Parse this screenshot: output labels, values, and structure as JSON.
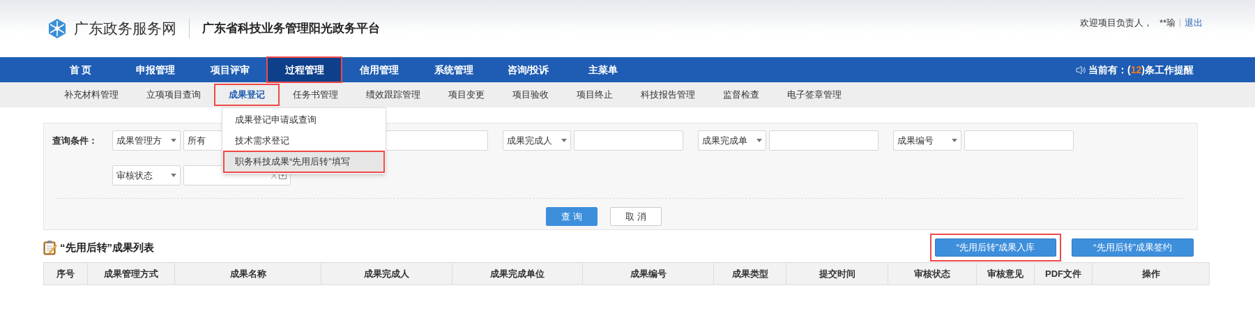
{
  "header": {
    "portal_name": "广东政务服务网",
    "platform_title": "广东省科技业务管理阳光政务平台",
    "welcome": "欢迎项目负责人，",
    "user": "**瑜",
    "logout": "退出"
  },
  "main_nav": {
    "items": [
      {
        "label": "首 页",
        "selected": false,
        "highlighted": false
      },
      {
        "label": "申报管理",
        "selected": false,
        "highlighted": false
      },
      {
        "label": "项目评审",
        "selected": false,
        "highlighted": false
      },
      {
        "label": "过程管理",
        "selected": true,
        "highlighted": true
      },
      {
        "label": "信用管理",
        "selected": false,
        "highlighted": false
      },
      {
        "label": "系统管理",
        "selected": false,
        "highlighted": false
      },
      {
        "label": "咨询/投诉",
        "selected": false,
        "highlighted": false
      },
      {
        "label": "主菜单",
        "selected": false,
        "highlighted": false
      }
    ],
    "notice": {
      "prefix": "当前有：(",
      "count": "12",
      "suffix": ")条工作提醒"
    }
  },
  "sub_nav": {
    "items": [
      {
        "label": "补充材料管理",
        "selected": false,
        "highlighted": false
      },
      {
        "label": "立项项目查询",
        "selected": false,
        "highlighted": false
      },
      {
        "label": "成果登记",
        "selected": true,
        "highlighted": true
      },
      {
        "label": "任务书管理",
        "selected": false,
        "highlighted": false
      },
      {
        "label": "绩效跟踪管理",
        "selected": false,
        "highlighted": false
      },
      {
        "label": "项目变更",
        "selected": false,
        "highlighted": false
      },
      {
        "label": "项目验收",
        "selected": false,
        "highlighted": false
      },
      {
        "label": "项目终止",
        "selected": false,
        "highlighted": false
      },
      {
        "label": "科技报告管理",
        "selected": false,
        "highlighted": false
      },
      {
        "label": "监督检查",
        "selected": false,
        "highlighted": false
      },
      {
        "label": "电子签章管理",
        "selected": false,
        "highlighted": false
      }
    ]
  },
  "dropdown_menu": {
    "items": [
      {
        "label": "成果登记申请或查询",
        "selected": false,
        "highlighted": false
      },
      {
        "label": "技术需求登记",
        "selected": false,
        "highlighted": false
      },
      {
        "label": "职务科技成果“先用后转”填写",
        "selected": true,
        "highlighted": true
      }
    ]
  },
  "query": {
    "label": "查询条件：",
    "rows": [
      [
        {
          "selector": "成果管理方",
          "value": "所有",
          "kind": "wide"
        },
        {
          "selector": "成果完成人",
          "kind": "text"
        },
        {
          "selector": "成果完成单",
          "kind": "text"
        },
        {
          "selector": "成果编号",
          "kind": "text"
        }
      ],
      [
        {
          "selector": "审核状态",
          "kind": "date"
        }
      ]
    ],
    "buttons": [
      {
        "label": "查 询",
        "kind": "primary"
      },
      {
        "label": "取 消",
        "kind": "secondary"
      }
    ]
  },
  "list": {
    "title": "“先用后转”成果列表",
    "actions": [
      {
        "label": "“先用后转”成果入库",
        "highlighted": true
      },
      {
        "label": "“先用后转”成果签约",
        "highlighted": false
      }
    ],
    "table": {
      "columns": [
        "序号",
        "成果管理方式",
        "成果名称",
        "成果完成人",
        "成果完成单位",
        "成果编号",
        "成果类型",
        "提交时间",
        "审核状态",
        "审核意见",
        "PDF文件",
        "操作"
      ]
    }
  }
}
